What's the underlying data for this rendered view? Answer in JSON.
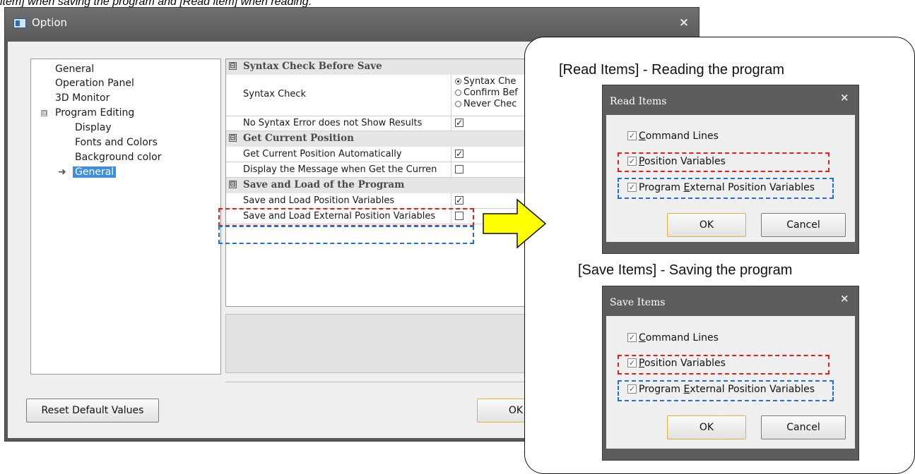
{
  "caption": "item] when saving the program and [Read item] when reading.",
  "option_window": {
    "title": "Option",
    "close_glyph": "×",
    "tree": {
      "items": [
        "General",
        "Operation Panel",
        "3D Monitor",
        "Program Editing",
        "Display",
        "Fonts and Colors",
        "Background color",
        "General"
      ],
      "expander": "⊟",
      "selected_marker": "➜"
    },
    "grid": {
      "categories": [
        {
          "marker": "⊟",
          "label": "Syntax Check Before Save"
        },
        {
          "marker": "⊟",
          "label": "Get Current Position"
        },
        {
          "marker": "⊟",
          "label": "Save and Load of the Program"
        }
      ],
      "rows": {
        "syntax_check": "Syntax Check",
        "syntax_options": [
          "Syntax Che",
          "Confirm Bef",
          "Never Chec"
        ],
        "no_syntax_error": "No Syntax Error does not Show Results",
        "get_pos_auto": "Get Current Position Automatically",
        "display_msg": "Display the Message when Get the Curren",
        "save_load_pos": "Save and Load Position Variables",
        "save_load_ext": "Save and Load External Position Variables"
      },
      "check_glyph": "✓"
    },
    "buttons": {
      "reset": "Reset Default Values",
      "ok": "OK"
    }
  },
  "callout": {
    "read_heading": "[Read Items] - Reading the program",
    "save_heading": "[Save Items] - Saving the program",
    "read_dialog": {
      "title": "Read Items",
      "close_glyph": "×",
      "items": [
        {
          "pre": "",
          "u": "C",
          "post": "ommand Lines"
        },
        {
          "pre": "",
          "u": "P",
          "post": "osition Variables"
        },
        {
          "pre": "Program ",
          "u": "E",
          "post": "xternal Position Variables"
        }
      ],
      "ok": "OK",
      "cancel": "Cancel"
    },
    "save_dialog": {
      "title": "Save Items",
      "close_glyph": "×",
      "items": [
        {
          "pre": "",
          "u": "C",
          "post": "ommand Lines"
        },
        {
          "pre": "",
          "u": "P",
          "post": "osition Variables"
        },
        {
          "pre": "Program ",
          "u": "E",
          "post": "xternal Position Variables"
        }
      ],
      "ok": "OK",
      "cancel": "Cancel"
    },
    "check_glyph": "✓"
  },
  "colors": {
    "highlight_red": "#e02020",
    "highlight_blue": "#1f6fd6",
    "arrow_fill": "#ffff00"
  }
}
